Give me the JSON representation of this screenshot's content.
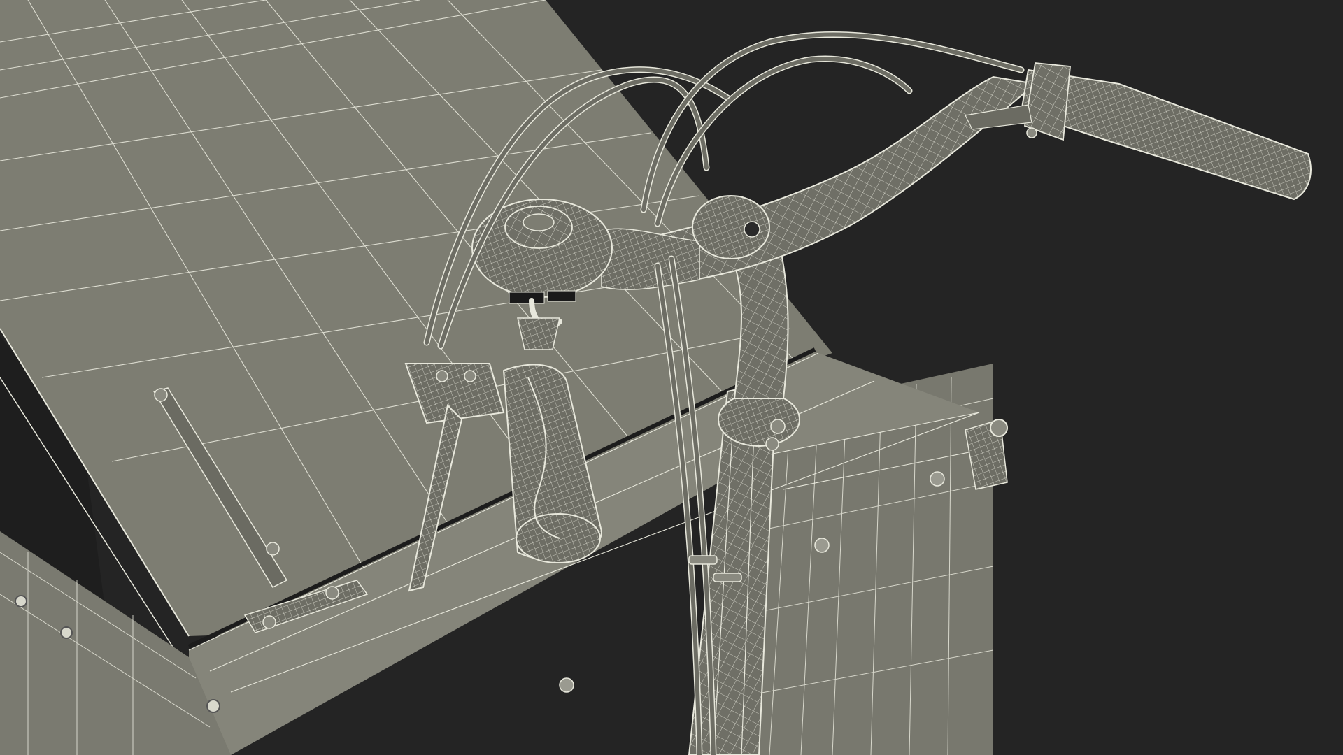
{
  "scene": {
    "background_color": "#242424",
    "surface_color": "#7d7d72",
    "surface_dark": "#6e6e64",
    "surface_light": "#8c8c82",
    "wire_color": "#e8e8dc",
    "shadow_color": "#1a1a1a",
    "icon_names": [
      "handlebar-icon",
      "grip-icon",
      "bell-icon",
      "hinge-icon",
      "cable-icon",
      "box-lid-icon"
    ]
  }
}
